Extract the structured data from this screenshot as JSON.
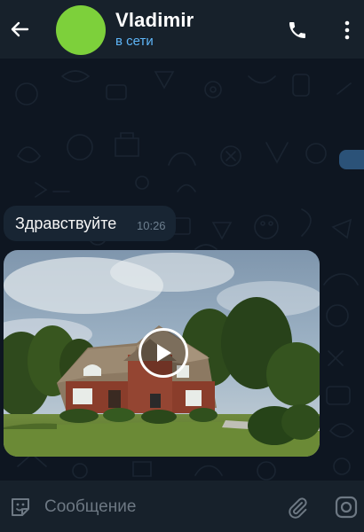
{
  "header": {
    "contact_name": "Vladimir",
    "status": "в сети",
    "avatar_color": "#7dd03b",
    "icons": [
      "back-arrow-icon",
      "phone-icon",
      "more-vertical-icon"
    ]
  },
  "messages": [
    {
      "type": "text",
      "text": "Здравствуйте",
      "time": "10:26",
      "incoming": true
    },
    {
      "type": "video",
      "thumbnail": "house-photo",
      "icon": "play-icon",
      "incoming": true
    }
  ],
  "input": {
    "placeholder": "Сообщение",
    "icons": [
      "sticker-icon",
      "paperclip-icon",
      "camera-icon"
    ]
  },
  "colors": {
    "background": "#0e1621",
    "header": "#17212b",
    "incoming_bubble": "#182533",
    "accent": "#5eb5f7"
  }
}
